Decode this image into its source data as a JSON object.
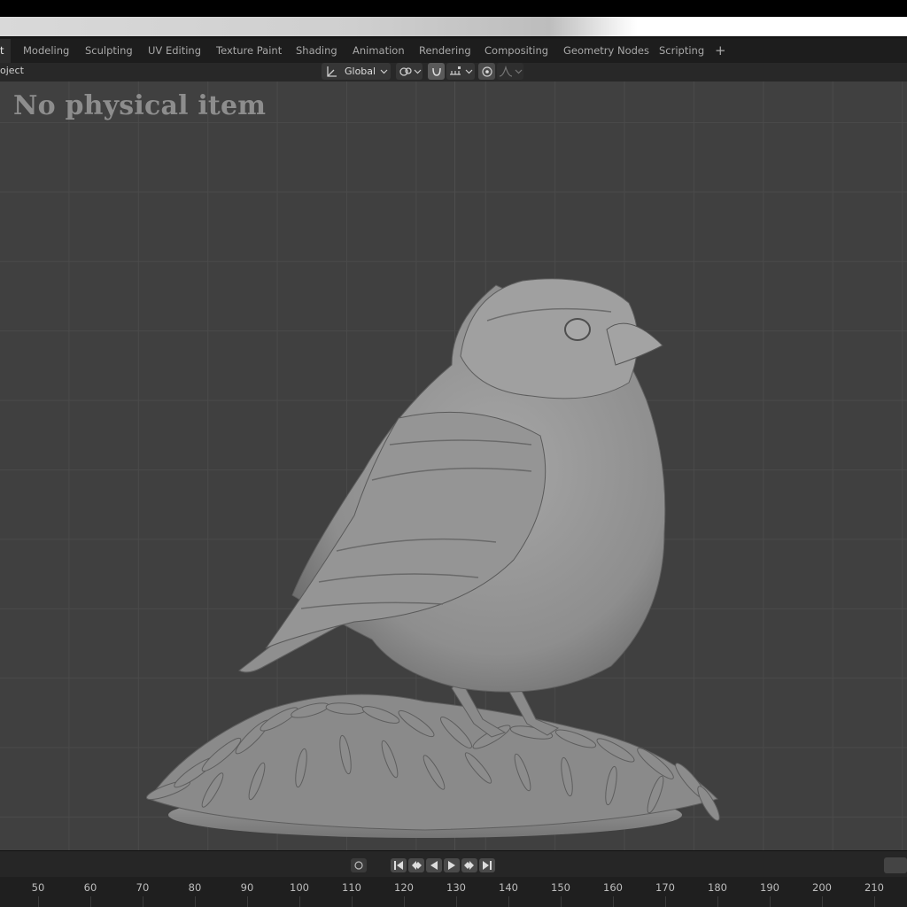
{
  "workspace_tabs": [
    {
      "label": "t",
      "active": true
    },
    {
      "label": "Modeling"
    },
    {
      "label": "Sculpting"
    },
    {
      "label": "UV Editing"
    },
    {
      "label": "Texture Paint"
    },
    {
      "label": "Shading"
    },
    {
      "label": "Animation"
    },
    {
      "label": "Rendering"
    },
    {
      "label": "Compositing"
    },
    {
      "label": "Geometry Nodes"
    },
    {
      "label": "Scripting"
    },
    {
      "label": "+"
    }
  ],
  "toolbar": {
    "object_label": "oject",
    "transform_orientation": "Global",
    "icons": [
      "transform-orientation-icon",
      "pivot-link-icon",
      "snap-icon",
      "snap-increment-icon",
      "proportional-edit-icon",
      "falloff-curve-icon"
    ]
  },
  "viewport": {
    "watermark": "No physical item",
    "model": "sculpted bird on grassy base"
  },
  "playback": {
    "icons": [
      "keyframe-dot-icon",
      "jump-start-icon",
      "prev-keyframe-icon",
      "play-reverse-icon",
      "play-icon",
      "next-keyframe-icon",
      "jump-end-icon"
    ]
  },
  "timeline": {
    "frames": [
      "50",
      "60",
      "70",
      "80",
      "90",
      "100",
      "110",
      "120",
      "130",
      "140",
      "150",
      "160",
      "170",
      "180",
      "190",
      "200",
      "210"
    ]
  },
  "colors": {
    "viewport_bg": "#404040",
    "grid": "#4a4a4a",
    "model": "#9a9a9a"
  }
}
